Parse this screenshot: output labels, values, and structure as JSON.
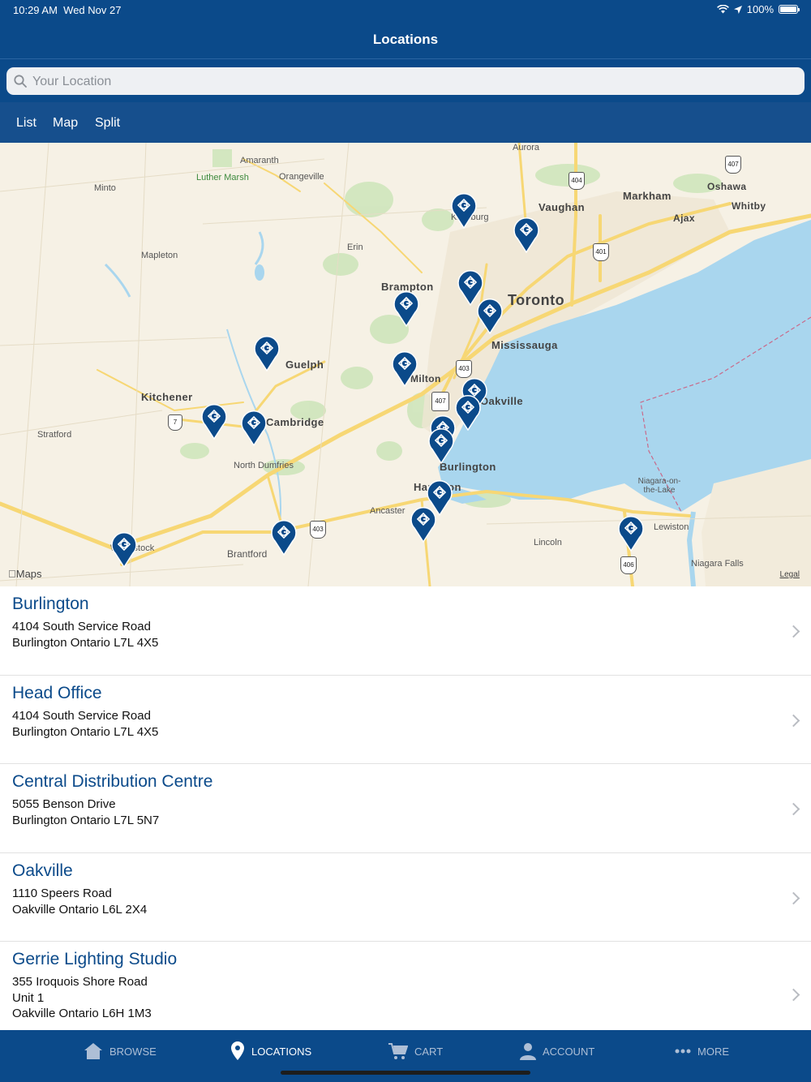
{
  "status_bar": {
    "time": "10:29 AM",
    "date": "Wed Nov 27",
    "battery": "100%"
  },
  "nav": {
    "title": "Locations"
  },
  "search": {
    "placeholder": "Your Location"
  },
  "segments": [
    "List",
    "Map",
    "Split"
  ],
  "map": {
    "labels": {
      "aurora": "Aurora",
      "amaranth": "Amaranth",
      "orangeville": "Orangeville",
      "luther_marsh": "Luther Marsh",
      "minto": "Minto",
      "mapleton": "Mapleton",
      "erin": "Erin",
      "kleinburg": "Kleinburg",
      "vaughan": "Vaughan",
      "markham": "Markham",
      "oshawa": "Oshawa",
      "whitby": "Whitby",
      "ajax": "Ajax",
      "brampton": "Brampton",
      "toronto": "Toronto",
      "mississauga": "Mississauga",
      "guelph": "Guelph",
      "milton": "Milton",
      "oakville": "Oakville",
      "kitchener": "Kitchener",
      "cambridge": "Cambridge",
      "stratford": "Stratford",
      "north_dumfries": "North Dumfries",
      "burlington": "Burlington",
      "hamilton": "Hamilton",
      "ancaster": "Ancaster",
      "niagara_otl": "Niagara-on-the-Lake",
      "lewiston": "Lewiston",
      "lincoln": "Lincoln",
      "niagara_falls": "Niagara Falls",
      "woodstock": "Woodstock",
      "brantford": "Brantford"
    },
    "shields": {
      "h404": "404",
      "h407a": "407",
      "h401": "401",
      "h403a": "403",
      "h407b": "407",
      "h7": "7",
      "h403b": "403",
      "h406": "406"
    },
    "maps_logo": "Maps",
    "legal": "Legal"
  },
  "locations": [
    {
      "name": "Burlington",
      "lines": [
        "4104 South Service Road",
        "Burlington Ontario L7L 4X5"
      ]
    },
    {
      "name": "Head Office",
      "lines": [
        "4104 South Service Road",
        "Burlington Ontario L7L 4X5"
      ]
    },
    {
      "name": "Central Distribution Centre",
      "lines": [
        "5055 Benson Drive",
        "Burlington Ontario L7L 5N7"
      ]
    },
    {
      "name": "Oakville",
      "lines": [
        "1110 Speers Road",
        "Oakville Ontario L6L 2X4"
      ]
    },
    {
      "name": "Gerrie Lighting Studio",
      "lines": [
        "355 Iroquois Shore Road",
        "Unit 1",
        "Oakville Ontario L6H 1M3"
      ]
    }
  ],
  "tabs": [
    {
      "label": "BROWSE",
      "icon": "house-icon",
      "active": false
    },
    {
      "label": "LOCATIONS",
      "icon": "location-pin-icon",
      "active": true
    },
    {
      "label": "CART",
      "icon": "cart-icon",
      "active": false
    },
    {
      "label": "ACCOUNT",
      "icon": "person-icon",
      "active": false
    },
    {
      "label": "MORE",
      "icon": "ellipsis-icon",
      "active": false
    }
  ],
  "colors": {
    "brand": "#0b4a8a",
    "water": "#a9d6ee",
    "land": "#f6f1e5",
    "road": "#f7d774",
    "green": "#c7e2b2"
  }
}
